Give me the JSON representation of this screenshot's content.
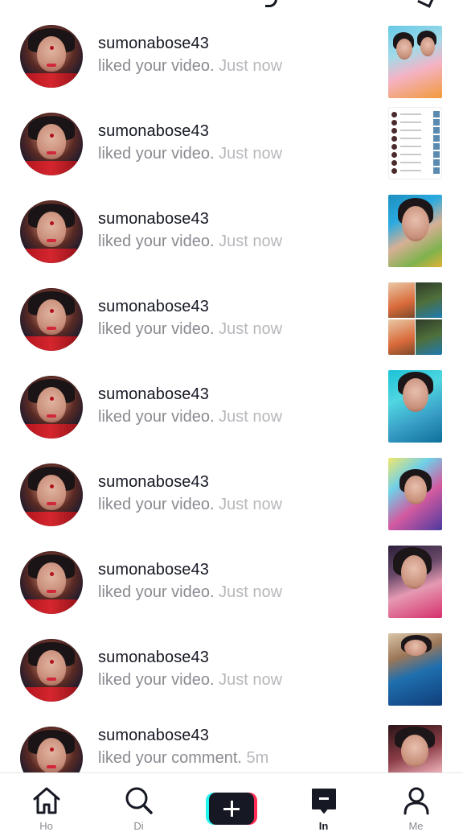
{
  "activity": {
    "items": [
      {
        "username": "sumonabose43",
        "message": "liked your video.",
        "time": "Just now"
      },
      {
        "username": "sumonabose43",
        "message": "liked your video.",
        "time": "Just now"
      },
      {
        "username": "sumonabose43",
        "message": "liked your video.",
        "time": "Just now"
      },
      {
        "username": "sumonabose43",
        "message": "liked your video.",
        "time": "Just now"
      },
      {
        "username": "sumonabose43",
        "message": "liked your video.",
        "time": "Just now"
      },
      {
        "username": "sumonabose43",
        "message": "liked your video.",
        "time": "Just now"
      },
      {
        "username": "sumonabose43",
        "message": "liked your video.",
        "time": "Just now"
      },
      {
        "username": "sumonabose43",
        "message": "liked your video.",
        "time": "Just now"
      },
      {
        "username": "sumonabose43",
        "message": "liked your comment.",
        "time": "5m"
      }
    ]
  },
  "tabbar": {
    "tabs": [
      {
        "icon": "home-icon",
        "label": "Ho"
      },
      {
        "icon": "search-icon",
        "label": "Di"
      },
      {
        "icon": "create-plus-icon",
        "label": ""
      },
      {
        "icon": "inbox-icon",
        "label": "In"
      },
      {
        "icon": "profile-icon",
        "label": "Me"
      }
    ]
  },
  "colors": {
    "text_primary": "#161823",
    "text_secondary": "#8a8b91",
    "accent_cyan": "#25f4ee",
    "accent_pink": "#fe2c55"
  }
}
